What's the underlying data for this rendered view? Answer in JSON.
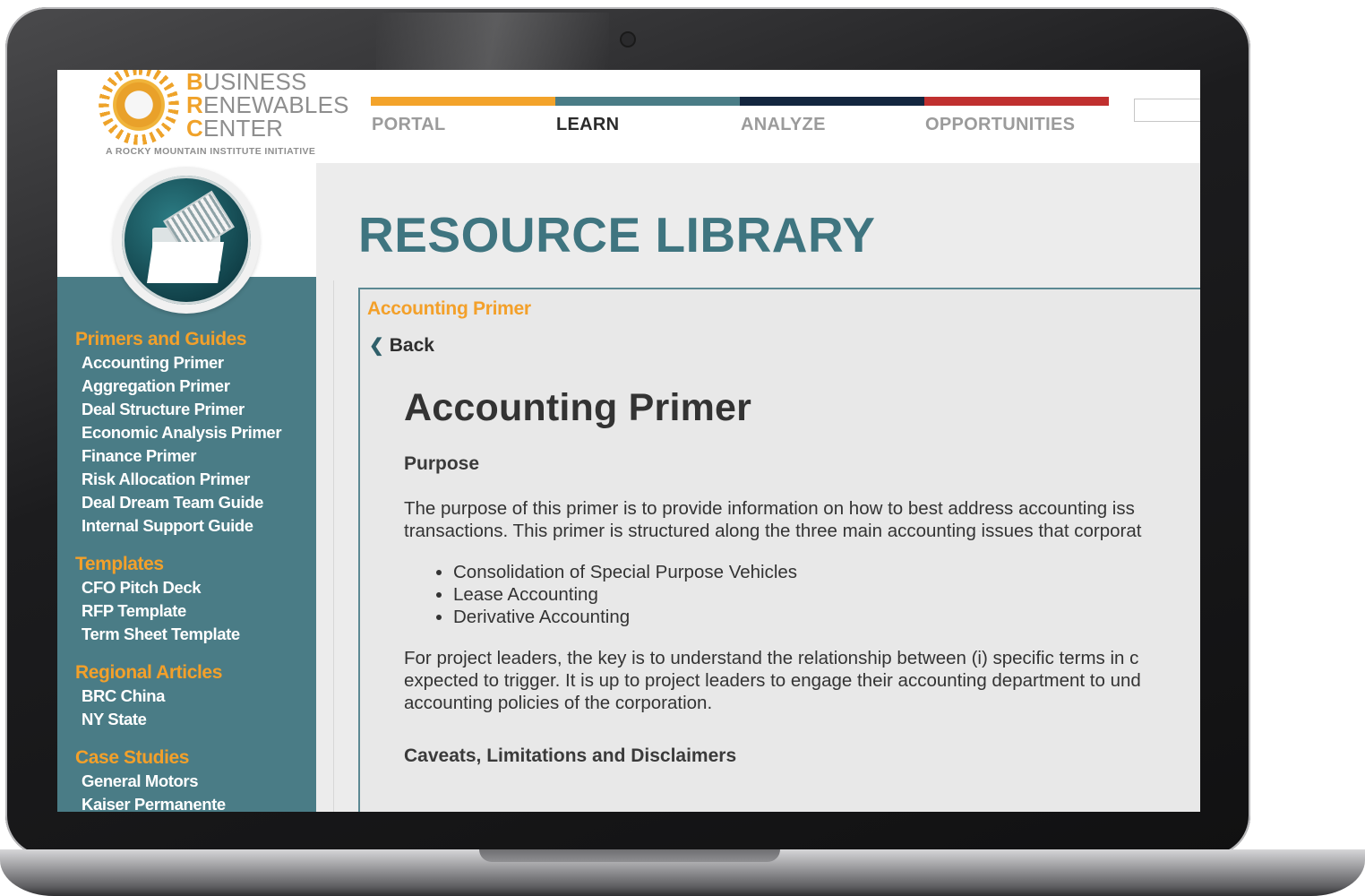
{
  "brand": {
    "line1_initial": "B",
    "line1_rest": "USINESS",
    "line2_initial": "R",
    "line2_rest": "ENEWABLES",
    "line3_initial": "C",
    "line3_rest": "ENTER",
    "tagline": "A ROCKY MOUNTAIN INSTITUTE INITIATIVE"
  },
  "nav": {
    "items": [
      {
        "label": "PORTAL",
        "color": "#f3a32a"
      },
      {
        "label": "LEARN",
        "color": "#4a7c86"
      },
      {
        "label": "ANALYZE",
        "color": "#13263f"
      },
      {
        "label": "OPPORTUNITIES",
        "color": "#c0302f"
      }
    ],
    "active": "LEARN"
  },
  "page_title": "RESOURCE LIBRARY",
  "sidebar": {
    "sections": [
      {
        "heading": "Primers and Guides",
        "links": [
          "Accounting Primer",
          "Aggregation Primer",
          "Deal Structure Primer",
          "Economic Analysis Primer",
          "Finance Primer",
          "Risk Allocation Primer",
          "Deal Dream Team Guide",
          "Internal Support Guide"
        ]
      },
      {
        "heading": "Templates",
        "links": [
          "CFO Pitch Deck",
          "RFP Template",
          "Term Sheet Template"
        ]
      },
      {
        "heading": "Regional Articles",
        "links": [
          "BRC China",
          "NY State"
        ]
      },
      {
        "heading": "Case Studies",
        "links": [
          "General Motors",
          "Kaiser Permanente"
        ]
      }
    ]
  },
  "content": {
    "breadcrumb": "Accounting Primer",
    "back_label": "Back",
    "title": "Accounting Primer",
    "purpose_heading": "Purpose",
    "purpose_text_1": "The purpose of this primer is to provide information on how to best address accounting iss",
    "purpose_text_2": "transactions. This primer is structured along the three main accounting issues that corporat",
    "bullets": [
      "Consolidation of Special Purpose Vehicles",
      "Lease Accounting",
      "Derivative Accounting"
    ],
    "leaders_text_1": "For project leaders, the key is to understand the relationship between (i) specific terms in c",
    "leaders_text_2": "expected to trigger. It is up to project leaders to engage their accounting department to und",
    "leaders_text_3": "accounting policies of the corporation.",
    "caveats_heading": "Caveats, Limitations and Disclaimers"
  },
  "colors": {
    "teal": "#4a7c86",
    "orange": "#f3a02a",
    "title_teal": "#3f7580"
  }
}
